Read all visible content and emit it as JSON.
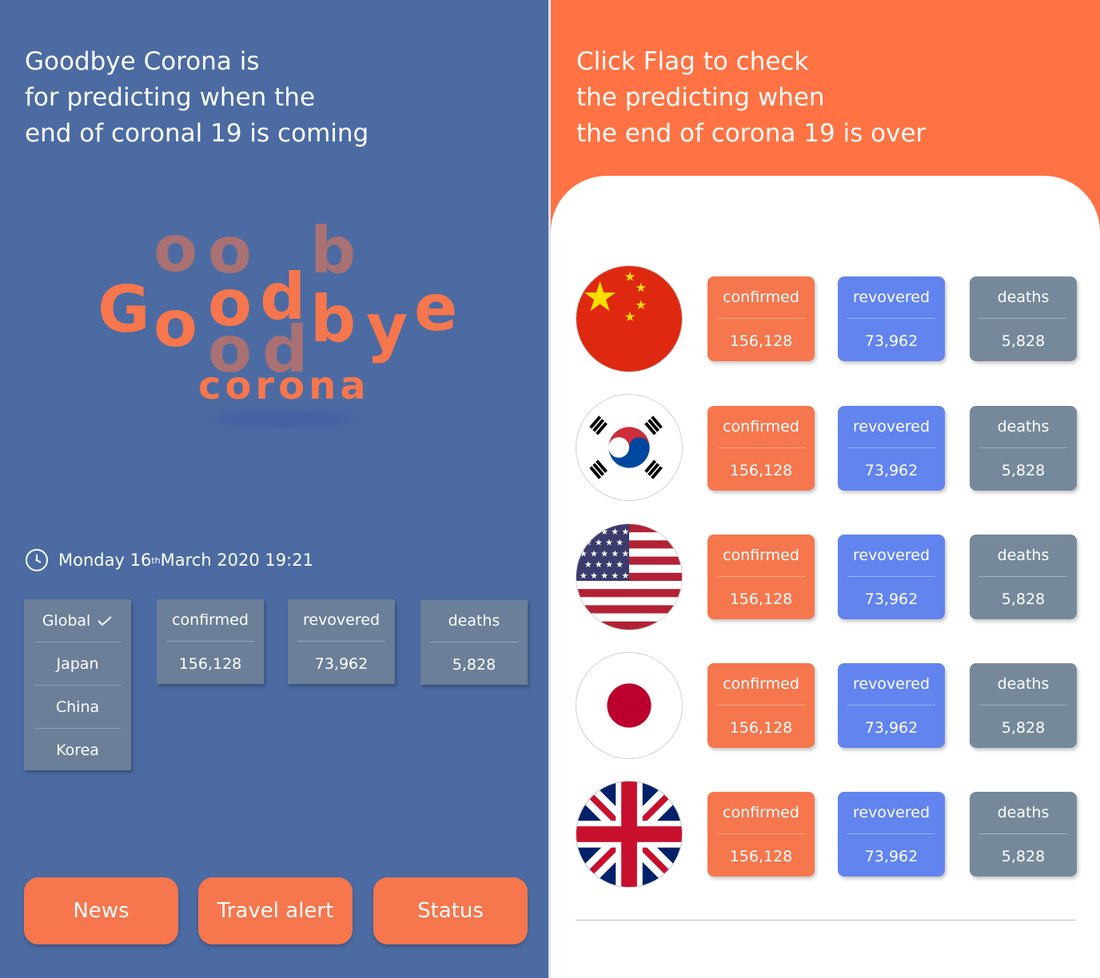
{
  "left": {
    "intro_lines": [
      "Goodbye Corona is",
      "for predicting when the",
      "end of coronal 19 is coming"
    ],
    "logo": {
      "letters": [
        "G",
        "o",
        "o",
        "d",
        "b",
        "y",
        "e"
      ],
      "sub": "corona"
    },
    "datetime": {
      "day": "Monday 16",
      "suffix": "th",
      "rest": " March 2020 19:21"
    },
    "regions": [
      "Global",
      "Japan",
      "China",
      "Korea"
    ],
    "stats": [
      {
        "label": "confirmed",
        "value": "156,128"
      },
      {
        "label": "revovered",
        "value": "73,962"
      },
      {
        "label": "deaths",
        "value": "5,828"
      }
    ],
    "buttons": [
      "News",
      "Travel alert",
      "Status"
    ]
  },
  "right": {
    "title_lines": [
      "Click Flag to check",
      "the predicting when",
      "the end of corona 19 is over"
    ],
    "rows": [
      {
        "flag": "china-flag-icon",
        "confirmed": "156,128",
        "recovered": "73,962",
        "deaths": "5,828"
      },
      {
        "flag": "korea-flag-icon",
        "confirmed": "156,128",
        "recovered": "73,962",
        "deaths": "5,828"
      },
      {
        "flag": "usa-flag-icon",
        "confirmed": "156,128",
        "recovered": "73,962",
        "deaths": "5,828"
      },
      {
        "flag": "japan-flag-icon",
        "confirmed": "156,128",
        "recovered": "73,962",
        "deaths": "5,828"
      },
      {
        "flag": "uk-flag-icon",
        "confirmed": "156,128",
        "recovered": "73,962",
        "deaths": "5,828"
      }
    ],
    "labels": {
      "confirmed": "confirmed",
      "recovered": "revovered",
      "deaths": "deaths"
    }
  },
  "colors": {
    "left_bg": "#4b6ba2",
    "right_bg": "#ff7243",
    "accent": "#f6764d",
    "blue": "#6284ef",
    "gray": "#75899b",
    "slate": "#6b7f99"
  },
  "icons": [
    "clock-icon",
    "check-icon"
  ]
}
